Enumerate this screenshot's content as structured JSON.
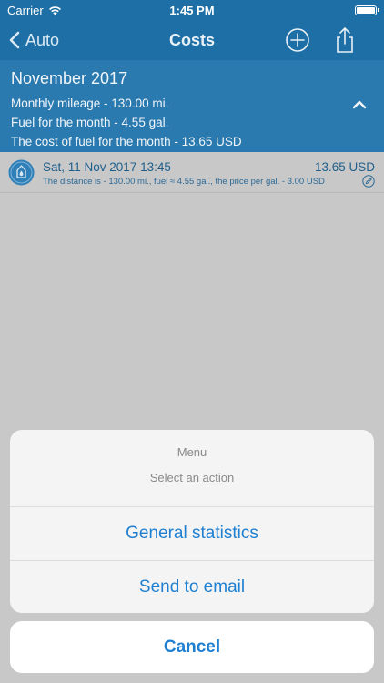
{
  "status_bar": {
    "carrier": "Carrier",
    "time": "1:45 PM"
  },
  "nav": {
    "back_label": "Auto",
    "title": "Costs"
  },
  "summary": {
    "month": "November 2017",
    "mileage": "Monthly mileage - 130.00 mi.",
    "fuel": "Fuel for the month - 4.55 gal.",
    "cost": "The cost of fuel for the month - 13.65 USD"
  },
  "entries": [
    {
      "date": "Sat, 11 Nov 2017 13:45",
      "amount": "13.65 USD",
      "detail": "The distance is - 130.00 mi., fuel ≈ 4.55 gal., the price per gal. - 3.00 USD"
    }
  ],
  "action_sheet": {
    "title": "Menu",
    "message": "Select an action",
    "actions": [
      {
        "label": "General statistics"
      },
      {
        "label": "Send to email"
      }
    ],
    "cancel_label": "Cancel"
  },
  "colors": {
    "nav_bg": "#1d6fa5",
    "summary_bg": "#2a7ab0",
    "accent": "#1f7fd1"
  }
}
